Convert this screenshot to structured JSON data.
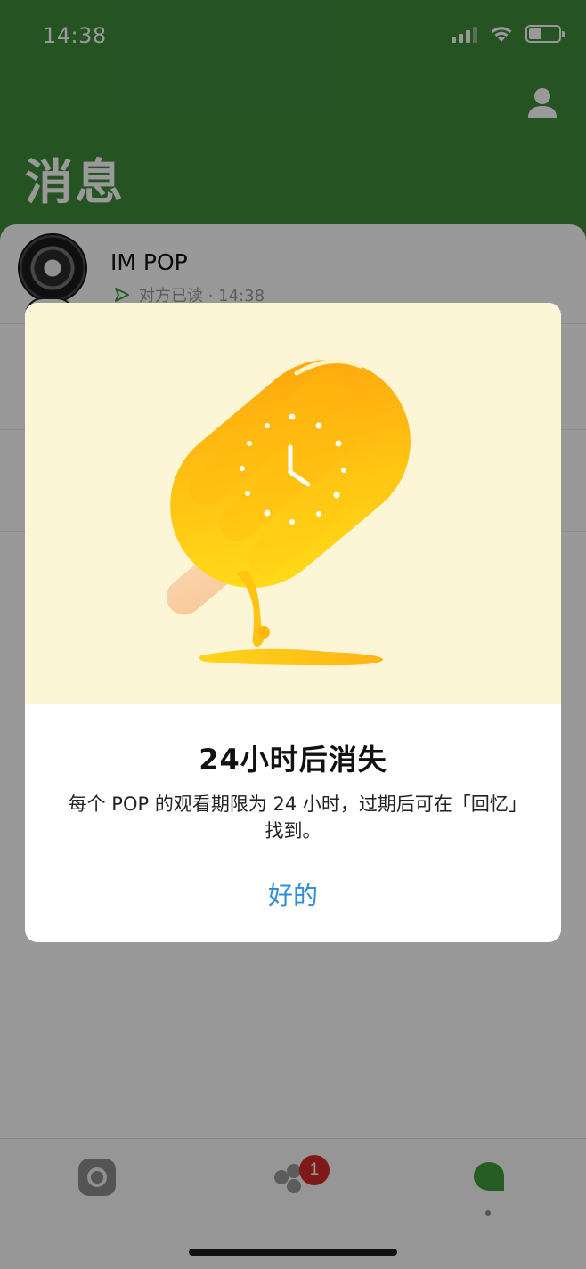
{
  "status_bar": {
    "time": "14:38"
  },
  "header": {
    "title": "消息"
  },
  "chat_list": [
    {
      "name": "IM POP",
      "status": "对方已读 · 14:38"
    }
  ],
  "dialog": {
    "title": "24小时后消失",
    "message": "每个 POP 的观看期限为 24 小时，过期后可在「回忆」找到。",
    "confirm_label": "好的"
  },
  "tabbar": {
    "badge_count": "1",
    "items": [
      "camera-icon",
      "friends-icon",
      "messages-icon"
    ]
  },
  "colors": {
    "header_green": "#3e8a3a",
    "accent_blue": "#2f8edc",
    "badge_red": "#d42b2b",
    "illustration_bg": "#fdf6d6"
  }
}
